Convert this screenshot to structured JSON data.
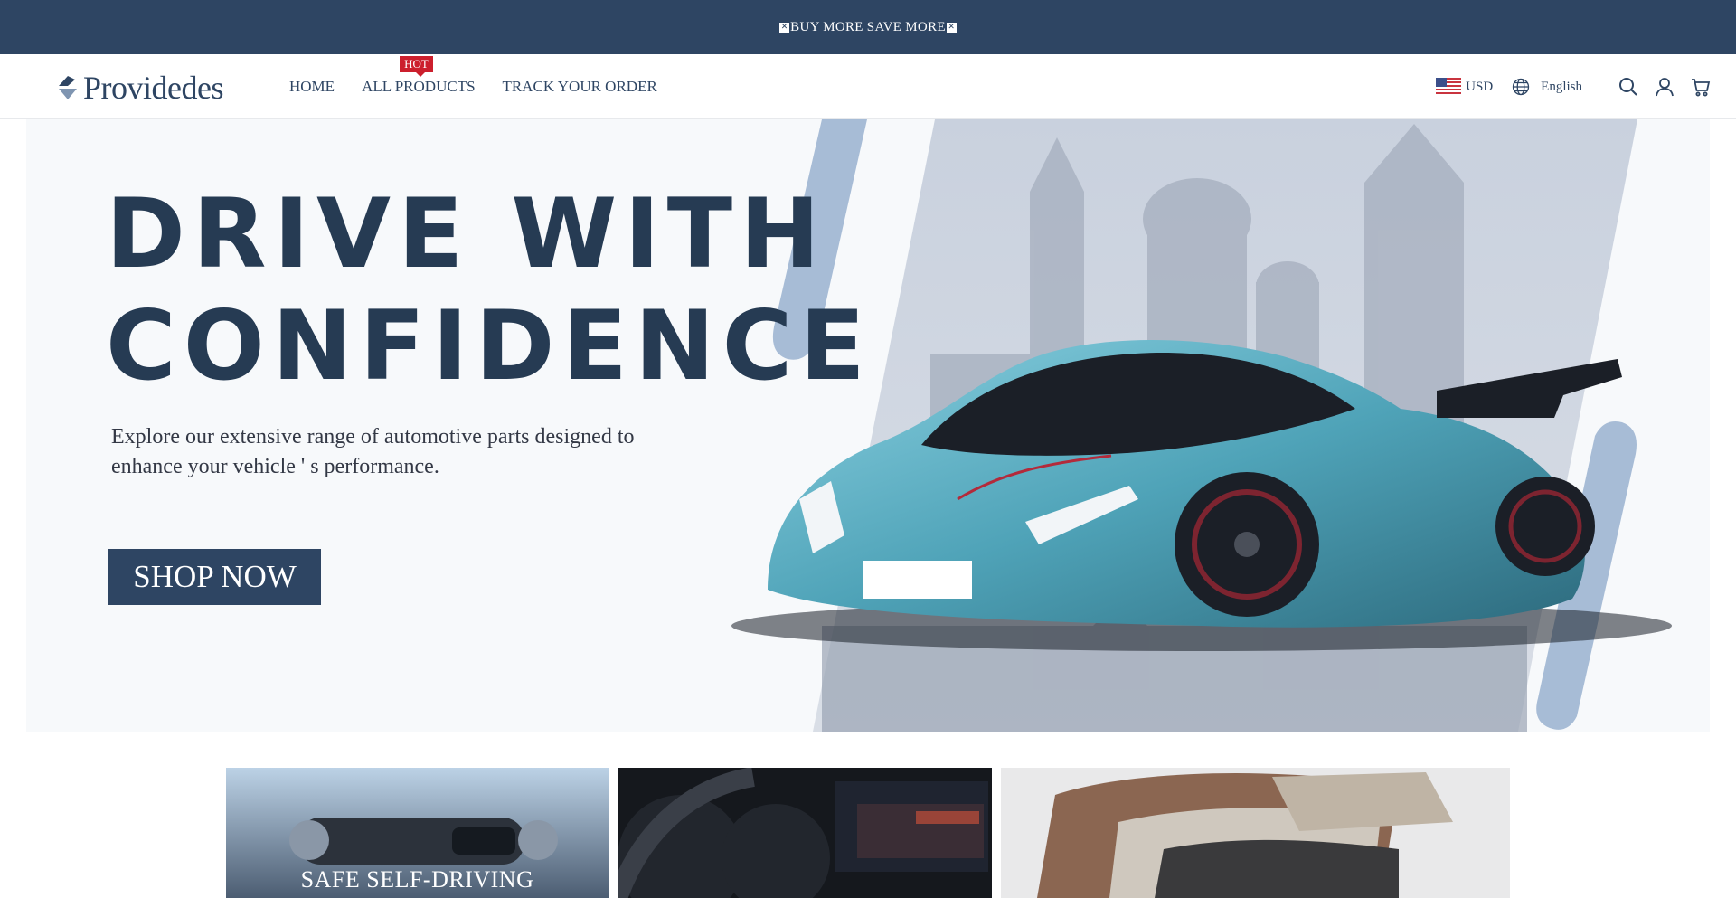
{
  "announcement": {
    "text": "BUY MORE SAVE MORE"
  },
  "brand": {
    "name": "Providedes"
  },
  "nav": {
    "items": [
      {
        "label": "HOME"
      },
      {
        "label": "ALL PRODUCTS",
        "badge": "HOT"
      },
      {
        "label": "TRACK YOUR ORDER"
      }
    ]
  },
  "header_tools": {
    "currency": "USD",
    "language": "English",
    "icons": [
      "flag-us-icon",
      "globe-icon",
      "search-icon",
      "account-icon",
      "cart-icon"
    ]
  },
  "hero": {
    "title_line1": "DRIVE WITH",
    "title_line2": "CONFIDENCE",
    "subtitle_line1": "Explore our extensive range of automotive parts designed to",
    "subtitle_line2": "enhance your vehicle ' s performance.",
    "cta": "SHOP NOW"
  },
  "categories": [
    {
      "label": "SAFE SELF-DRIVING"
    },
    {
      "label": ""
    },
    {
      "label": ""
    }
  ],
  "colors": {
    "navy": "#2e4563",
    "hot_badge": "#cc1f2d",
    "car_body": "#5fb0c4",
    "accent_stripe": "#a7bcd6"
  }
}
